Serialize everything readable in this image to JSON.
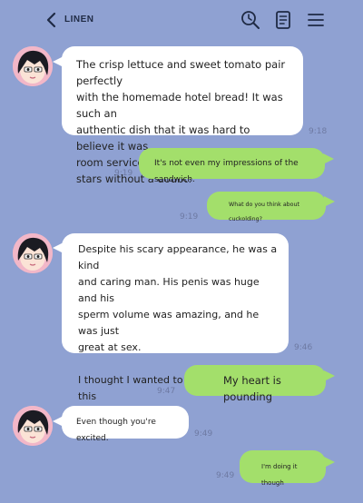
{
  "header": {
    "back_icon": "chevron-left-icon",
    "title": "LINEN",
    "icons": [
      "search-clock-icon",
      "document-icon",
      "menu-icon"
    ]
  },
  "colors": {
    "background": "#8fa1d2",
    "incoming_bubble": "#ffffff",
    "outgoing_bubble": "#a3df6b",
    "text": "#222222",
    "time": "#6e7aa3"
  },
  "messages": [
    {
      "direction": "incoming",
      "text": "The crisp lettuce and sweet tomato pair perfectly\nwith the homemade hotel bread! It was such an\nauthentic dish that it was hard to believe it was\nroom service from a love hotel! Five\nstars without a doubt!",
      "time": "9:18"
    },
    {
      "direction": "outgoing",
      "text": "It's not even my impressions of the sandwich.",
      "time": "9:19"
    },
    {
      "direction": "outgoing",
      "text": "What do you think about cuckolding?",
      "time": "9:19"
    },
    {
      "direction": "incoming",
      "text": "Despite his scary appearance, he was a kind\nand caring man. His penis was huge and his\nsperm volume was amazing, and he was just\ngreat at sex.\n\nI thought I wanted to do it again with this\nperson. Five stars.",
      "time": "9:46"
    },
    {
      "direction": "outgoing",
      "text": "My heart is pounding",
      "time": "9:47"
    },
    {
      "direction": "incoming",
      "text": "Even though you're excited.",
      "time": "9:49"
    },
    {
      "direction": "outgoing",
      "text": "I'm doing it though",
      "time": "9:49"
    }
  ]
}
